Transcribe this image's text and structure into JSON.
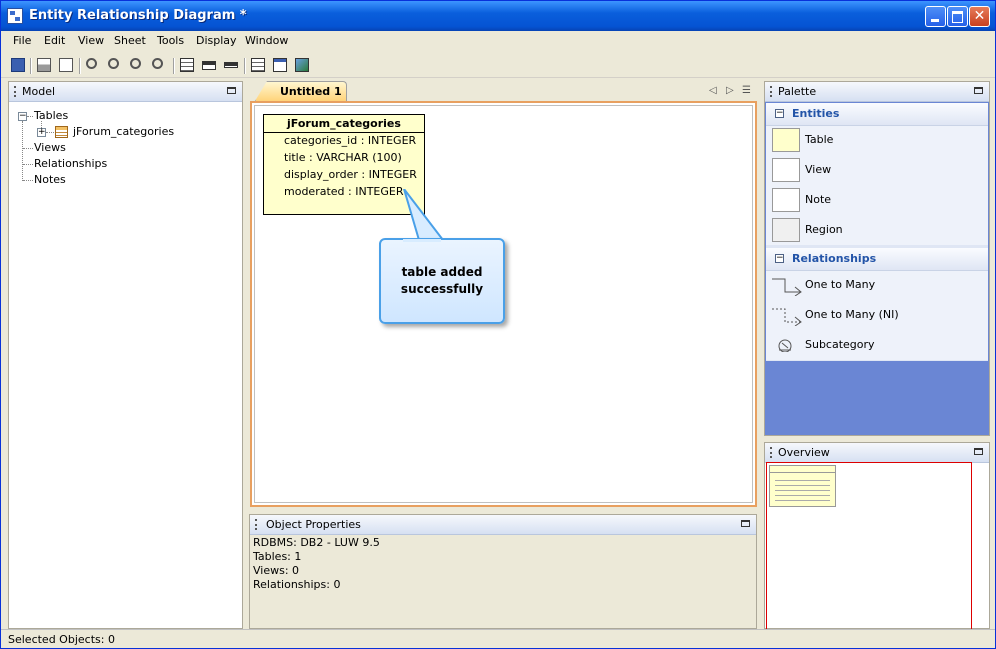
{
  "window": {
    "title": "Entity Relationship Diagram *"
  },
  "menu": [
    "File",
    "Edit",
    "View",
    "Sheet",
    "Tools",
    "Display",
    "Window"
  ],
  "toolbar_icons": [
    "save-icon",
    "print-icon",
    "page-setup-icon",
    "zoom-in-icon",
    "zoom-in-plus-icon",
    "zoom-out-icon",
    "zoom-fit-icon",
    "show-attributes-icon",
    "show-keys-icon",
    "show-names-icon",
    "layout-icon",
    "table-view-icon",
    "export-image-icon"
  ],
  "model": {
    "title": "Model",
    "tree": {
      "tables": "Tables",
      "table_item": "jForum_categories",
      "views": "Views",
      "relationships": "Relationships",
      "notes": "Notes"
    }
  },
  "editor": {
    "tab": "Untitled 1"
  },
  "entity": {
    "name": "jForum_categories",
    "attributes": [
      "categories_id : INTEGER",
      "title : VARCHAR (100)",
      "display_order : INTEGER",
      "moderated : INTEGER"
    ]
  },
  "callout": {
    "line1": "table added",
    "line2": "successfully"
  },
  "palette": {
    "title": "Palette",
    "entities": {
      "header": "Entities",
      "items": [
        "Table",
        "View",
        "Note",
        "Region"
      ]
    },
    "relationships": {
      "header": "Relationships",
      "items": [
        "One to Many",
        "One to Many (NI)",
        "Subcategory"
      ]
    }
  },
  "overview": {
    "title": "Overview"
  },
  "properties": {
    "title": "Object Properties",
    "lines": [
      "RDBMS: DB2 - LUW 9.5",
      "Tables: 1",
      "Views: 0",
      "Relationships: 0"
    ]
  },
  "status": {
    "text": "Selected Objects: 0"
  },
  "colors": {
    "titlebar": "#0553d3",
    "entity_fill": "#ffffcc",
    "palette_fill": "#6a86d4",
    "tab_fill": "#ffd37a"
  }
}
